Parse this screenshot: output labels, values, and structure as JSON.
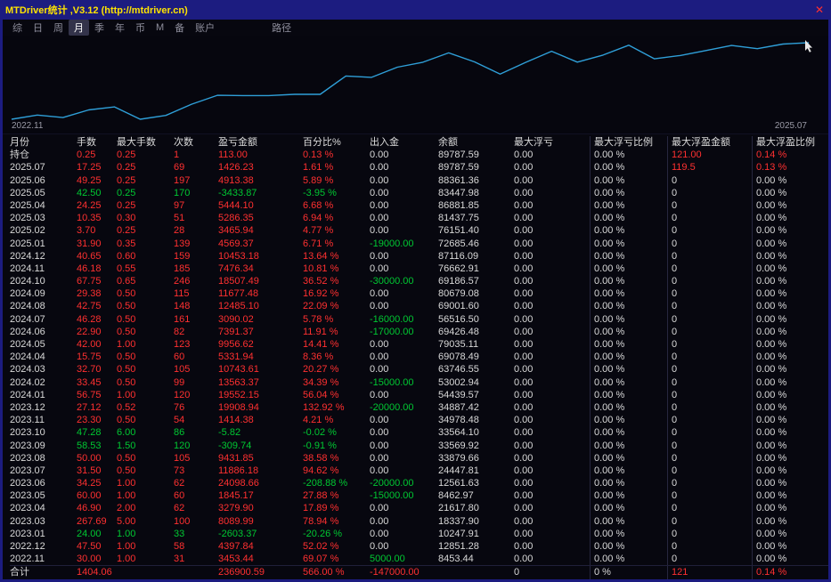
{
  "window": {
    "title": "MTDriver统计 ,V3.12 (http://mtdriver.cn)",
    "close_glyph": "✕"
  },
  "colors": {
    "red": "#ff3030",
    "green": "#00c832",
    "plain": "#d9d9d9",
    "line": "#2f9fd8",
    "title": "#ffe400",
    "chrome": "#1c1c80"
  },
  "menu": {
    "items": [
      {
        "label": "综",
        "active": false,
        "gap": false
      },
      {
        "label": "日",
        "active": false,
        "gap": false
      },
      {
        "label": "周",
        "active": false,
        "gap": false
      },
      {
        "label": "月",
        "active": true,
        "gap": false
      },
      {
        "label": "季",
        "active": false,
        "gap": false
      },
      {
        "label": "年",
        "active": false,
        "gap": false
      },
      {
        "label": "币",
        "active": false,
        "gap": false
      },
      {
        "label": "M",
        "active": false,
        "gap": false
      },
      {
        "label": "备",
        "active": false,
        "gap": false
      },
      {
        "label": "账户",
        "active": false,
        "gap": false
      },
      {
        "label": "路径",
        "active": false,
        "gap": true
      }
    ]
  },
  "chart_data": {
    "type": "line",
    "title": "账户余额曲线",
    "x_axis_labels": [
      "2022.11",
      "2025.07"
    ],
    "ylim": [
      8453.44,
      89787.59
    ],
    "grid": false,
    "legend": false,
    "series": [
      {
        "name": "余额",
        "x": [
          "2022.11",
          "2022.12",
          "2023.01",
          "2023.03",
          "2023.04",
          "2023.05",
          "2023.06",
          "2023.07",
          "2023.08",
          "2023.09",
          "2023.10",
          "2023.11",
          "2023.12",
          "2024.01",
          "2024.02",
          "2024.03",
          "2024.04",
          "2024.05",
          "2024.06",
          "2024.07",
          "2024.08",
          "2024.09",
          "2024.10",
          "2024.11",
          "2024.12",
          "2025.01",
          "2025.02",
          "2025.03",
          "2025.04",
          "2025.05",
          "2025.06",
          "2025.07"
        ],
        "values": [
          8453.44,
          12851.28,
          10247.91,
          18337.9,
          21617.8,
          8462.97,
          12561.63,
          24447.81,
          33879.66,
          33569.92,
          33564.1,
          34978.48,
          34887.42,
          54439.57,
          53002.94,
          63746.55,
          69078.49,
          79035.11,
          69426.48,
          56516.5,
          69001.6,
          80679.08,
          69186.57,
          76662.91,
          87116.09,
          72685.46,
          76151.4,
          81437.75,
          86881.85,
          83447.98,
          88361.36,
          89787.59
        ]
      }
    ]
  },
  "table": {
    "headers": [
      "月份",
      "手数",
      "最大手数",
      "次数",
      "盈亏金额",
      "百分比%",
      "出入金",
      "余额",
      "最大浮亏",
      "最大浮亏比例",
      "最大浮盈金额",
      "最大浮盈比例"
    ],
    "header_keys": [
      "month",
      "lots",
      "max-lots",
      "count",
      "pnl",
      "pct",
      "cash-flow",
      "balance",
      "max-float-loss",
      "max-float-loss-ratio",
      "max-float-profit",
      "max-float-profit-ratio"
    ],
    "rows": [
      {
        "v": [
          "持仓",
          "0.25",
          "0.25",
          "1",
          "113.00",
          "0.13 %",
          "0.00",
          "89787.59",
          "0.00",
          "0.00 %",
          "121.00",
          "0.14 %"
        ],
        "c": "wrrrrrwwwwrr"
      },
      {
        "v": [
          "2025.07",
          "17.25",
          "0.25",
          "69",
          "1426.23",
          "1.61 %",
          "0.00",
          "89787.59",
          "0.00",
          "0.00 %",
          "119.5",
          "0.13 %"
        ],
        "c": "wrrrrrwwwwrr"
      },
      {
        "v": [
          "2025.06",
          "49.25",
          "0.25",
          "197",
          "4913.38",
          "5.89 %",
          "0.00",
          "88361.36",
          "0.00",
          "0.00 %",
          "0",
          "0.00 %"
        ],
        "c": "wrrrrrwwwwww"
      },
      {
        "v": [
          "2025.05",
          "42.50",
          "0.25",
          "170",
          "-3433.87",
          "-3.95 %",
          "0.00",
          "83447.98",
          "0.00",
          "0.00 %",
          "0",
          "0.00 %"
        ],
        "c": "wgggggwwwwww"
      },
      {
        "v": [
          "2025.04",
          "24.25",
          "0.25",
          "97",
          "5444.10",
          "6.68 %",
          "0.00",
          "86881.85",
          "0.00",
          "0.00 %",
          "0",
          "0.00 %"
        ],
        "c": "wrrrrrwwwwww"
      },
      {
        "v": [
          "2025.03",
          "10.35",
          "0.30",
          "51",
          "5286.35",
          "6.94 %",
          "0.00",
          "81437.75",
          "0.00",
          "0.00 %",
          "0",
          "0.00 %"
        ],
        "c": "wrrrrrwwwwww"
      },
      {
        "v": [
          "2025.02",
          "3.70",
          "0.25",
          "28",
          "3465.94",
          "4.77 %",
          "0.00",
          "76151.40",
          "0.00",
          "0.00 %",
          "0",
          "0.00 %"
        ],
        "c": "wrrrrrwwwwww"
      },
      {
        "v": [
          "2025.01",
          "31.90",
          "0.35",
          "139",
          "4569.37",
          "6.71 %",
          "-19000.00",
          "72685.46",
          "0.00",
          "0.00 %",
          "0",
          "0.00 %"
        ],
        "c": "wrrrrrgwwwww"
      },
      {
        "v": [
          "2024.12",
          "40.65",
          "0.60",
          "159",
          "10453.18",
          "13.64 %",
          "0.00",
          "87116.09",
          "0.00",
          "0.00 %",
          "0",
          "0.00 %"
        ],
        "c": "wrrrrrwwwwww"
      },
      {
        "v": [
          "2024.11",
          "46.18",
          "0.55",
          "185",
          "7476.34",
          "10.81 %",
          "0.00",
          "76662.91",
          "0.00",
          "0.00 %",
          "0",
          "0.00 %"
        ],
        "c": "wrrrrrwwwwww"
      },
      {
        "v": [
          "2024.10",
          "67.75",
          "0.65",
          "246",
          "18507.49",
          "36.52 %",
          "-30000.00",
          "69186.57",
          "0.00",
          "0.00 %",
          "0",
          "0.00 %"
        ],
        "c": "wrrrrrgwwwww"
      },
      {
        "v": [
          "2024.09",
          "29.38",
          "0.50",
          "115",
          "11677.48",
          "16.92 %",
          "0.00",
          "80679.08",
          "0.00",
          "0.00 %",
          "0",
          "0.00 %"
        ],
        "c": "wrrrrrwwwwww"
      },
      {
        "v": [
          "2024.08",
          "42.75",
          "0.50",
          "148",
          "12485.10",
          "22.09 %",
          "0.00",
          "69001.60",
          "0.00",
          "0.00 %",
          "0",
          "0.00 %"
        ],
        "c": "wrrrrrwwwwww"
      },
      {
        "v": [
          "2024.07",
          "46.28",
          "0.50",
          "161",
          "3090.02",
          "5.78 %",
          "-16000.00",
          "56516.50",
          "0.00",
          "0.00 %",
          "0",
          "0.00 %"
        ],
        "c": "wrrrrrgwwwww"
      },
      {
        "v": [
          "2024.06",
          "22.90",
          "0.50",
          "82",
          "7391.37",
          "11.91 %",
          "-17000.00",
          "69426.48",
          "0.00",
          "0.00 %",
          "0",
          "0.00 %"
        ],
        "c": "wrrrrrgwwwww"
      },
      {
        "v": [
          "2024.05",
          "42.00",
          "1.00",
          "123",
          "9956.62",
          "14.41 %",
          "0.00",
          "79035.11",
          "0.00",
          "0.00 %",
          "0",
          "0.00 %"
        ],
        "c": "wrrrrrwwwwww"
      },
      {
        "v": [
          "2024.04",
          "15.75",
          "0.50",
          "60",
          "5331.94",
          "8.36 %",
          "0.00",
          "69078.49",
          "0.00",
          "0.00 %",
          "0",
          "0.00 %"
        ],
        "c": "wrrrrrwwwwww"
      },
      {
        "v": [
          "2024.03",
          "32.70",
          "0.50",
          "105",
          "10743.61",
          "20.27 %",
          "0.00",
          "63746.55",
          "0.00",
          "0.00 %",
          "0",
          "0.00 %"
        ],
        "c": "wrrrrrwwwwww"
      },
      {
        "v": [
          "2024.02",
          "33.45",
          "0.50",
          "99",
          "13563.37",
          "34.39 %",
          "-15000.00",
          "53002.94",
          "0.00",
          "0.00 %",
          "0",
          "0.00 %"
        ],
        "c": "wrrrrrgwwwww"
      },
      {
        "v": [
          "2024.01",
          "56.75",
          "1.00",
          "120",
          "19552.15",
          "56.04 %",
          "0.00",
          "54439.57",
          "0.00",
          "0.00 %",
          "0",
          "0.00 %"
        ],
        "c": "wrrrrrwwwwww"
      },
      {
        "v": [
          "2023.12",
          "27.12",
          "0.52",
          "76",
          "19908.94",
          "132.92 %",
          "-20000.00",
          "34887.42",
          "0.00",
          "0.00 %",
          "0",
          "0.00 %"
        ],
        "c": "wrrrrrgwwwww"
      },
      {
        "v": [
          "2023.11",
          "23.30",
          "0.50",
          "54",
          "1414.38",
          "4.21 %",
          "0.00",
          "34978.48",
          "0.00",
          "0.00 %",
          "0",
          "0.00 %"
        ],
        "c": "wrrrrrwwwwww"
      },
      {
        "v": [
          "2023.10",
          "47.28",
          "6.00",
          "86",
          "-5.82",
          "-0.02 %",
          "0.00",
          "33564.10",
          "0.00",
          "0.00 %",
          "0",
          "0.00 %"
        ],
        "c": "wgggggwwwwww"
      },
      {
        "v": [
          "2023.09",
          "58.53",
          "1.50",
          "120",
          "-309.74",
          "-0.91 %",
          "0.00",
          "33569.92",
          "0.00",
          "0.00 %",
          "0",
          "0.00 %"
        ],
        "c": "wgggggwwwwww"
      },
      {
        "v": [
          "2023.08",
          "50.00",
          "0.50",
          "105",
          "9431.85",
          "38.58 %",
          "0.00",
          "33879.66",
          "0.00",
          "0.00 %",
          "0",
          "0.00 %"
        ],
        "c": "wrrrrrwwwwww"
      },
      {
        "v": [
          "2023.07",
          "31.50",
          "0.50",
          "73",
          "11886.18",
          "94.62 %",
          "0.00",
          "24447.81",
          "0.00",
          "0.00 %",
          "0",
          "0.00 %"
        ],
        "c": "wrrrrrwwwwww"
      },
      {
        "v": [
          "2023.06",
          "34.25",
          "1.00",
          "62",
          "24098.66",
          "-208.88 %",
          "-20000.00",
          "12561.63",
          "0.00",
          "0.00 %",
          "0",
          "0.00 %"
        ],
        "c": "wrrrrggwwwww"
      },
      {
        "v": [
          "2023.05",
          "60.00",
          "1.00",
          "60",
          "1845.17",
          "27.88 %",
          "-15000.00",
          "8462.97",
          "0.00",
          "0.00 %",
          "0",
          "0.00 %"
        ],
        "c": "wrrrrrgwwwww"
      },
      {
        "v": [
          "2023.04",
          "46.90",
          "2.00",
          "62",
          "3279.90",
          "17.89 %",
          "0.00",
          "21617.80",
          "0.00",
          "0.00 %",
          "0",
          "0.00 %"
        ],
        "c": "wrrrrrwwwwww"
      },
      {
        "v": [
          "2023.03",
          "267.69",
          "5.00",
          "100",
          "8089.99",
          "78.94 %",
          "0.00",
          "18337.90",
          "0.00",
          "0.00 %",
          "0",
          "0.00 %"
        ],
        "c": "wrrrrrwwwwww"
      },
      {
        "v": [
          "2023.01",
          "24.00",
          "1.00",
          "33",
          "-2603.37",
          "-20.26 %",
          "0.00",
          "10247.91",
          "0.00",
          "0.00 %",
          "0",
          "0.00 %"
        ],
        "c": "wgggggwwwwww"
      },
      {
        "v": [
          "2022.12",
          "47.50",
          "1.00",
          "58",
          "4397.84",
          "52.02 %",
          "0.00",
          "12851.28",
          "0.00",
          "0.00 %",
          "0",
          "0.00 %"
        ],
        "c": "wrrrrrwwwwww"
      },
      {
        "v": [
          "2022.11",
          "30.00",
          "1.00",
          "31",
          "3453.44",
          "69.07 %",
          "5000.00",
          "8453.44",
          "0.00",
          "0.00 %",
          "0",
          "0.00 %"
        ],
        "c": "wrrrrrgwwwww"
      },
      {
        "v": [
          "合计",
          "1404.06",
          "",
          "",
          "236900.59",
          "566.00 %",
          "-147000.00",
          "",
          "0",
          "0 %",
          "121",
          "0.14 %"
        ],
        "c": "wrwwrrrwwwrr",
        "total": true
      }
    ]
  }
}
